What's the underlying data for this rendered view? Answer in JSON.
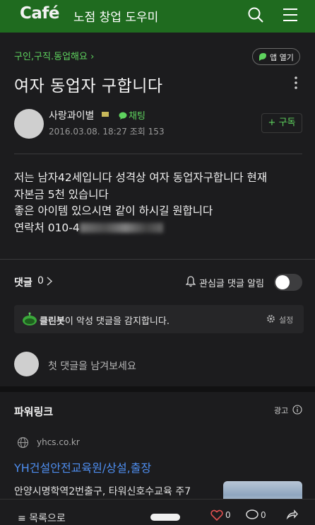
{
  "header": {
    "logo": "Café",
    "cafe_name": "노점 창업 도우미",
    "colors": {
      "header_bg": "#1f6b1f",
      "accent": "#5ed35e",
      "link": "#4e8ef0"
    }
  },
  "post": {
    "category": "구인,구직.동업해요 ›",
    "open_app_label": "앱 열기",
    "title": "여자 동업자 구합니다",
    "author": "사랑과이별",
    "chat_label": "채팅",
    "date": "2016.03.08. 18:27",
    "views_label": "조회",
    "views": "153",
    "subscribe_label": "구독",
    "body_lines": [
      "저는 남자42세입니다 성격상 여자 동업자구합니다 현재",
      "자본금 5천 있습니다",
      "좋은 아이템 있으시면 같이 하시길 원합니다"
    ],
    "contact_label": "연락처 010-4"
  },
  "comments": {
    "label": "댓글",
    "count": "0",
    "alert_label": "관심글 댓글 알림",
    "cleanbot_name": "클린봇",
    "cleanbot_text": "이 악성 댓글을 감지합니다.",
    "settings_label": "설정",
    "placeholder": "첫 댓글을 남겨보세요"
  },
  "powerlink": {
    "title": "파워링크",
    "ad_label": "광고",
    "domain": "yhcs.co.kr",
    "headline": "YH건설안전교육원/상설,출장",
    "description": "안양시명학역2번출구, 타워신호수교육 주7"
  },
  "bottom_bar": {
    "list_label": "목록으로",
    "likes": "0",
    "comments": "0"
  }
}
